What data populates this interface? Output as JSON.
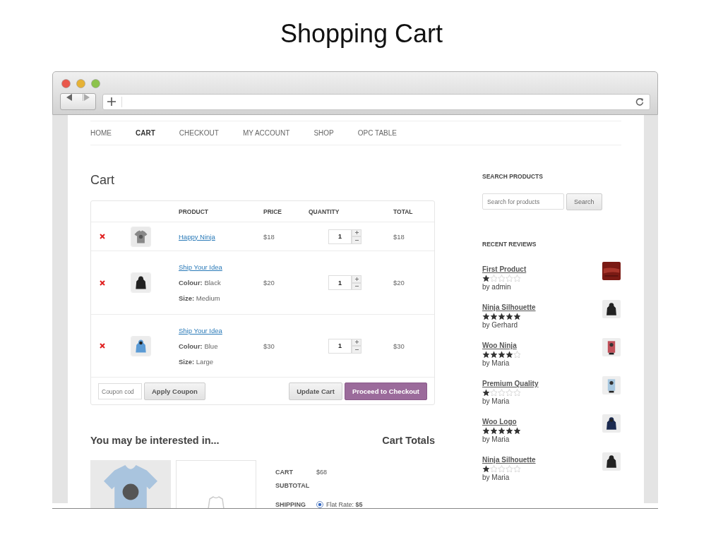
{
  "slide_title": "Shopping Cart",
  "nav": [
    {
      "label": "HOME",
      "selected": false
    },
    {
      "label": "CART",
      "selected": true
    },
    {
      "label": "CHECKOUT",
      "selected": false
    },
    {
      "label": "MY ACCOUNT",
      "selected": false
    },
    {
      "label": "SHOP",
      "selected": false
    },
    {
      "label": "OPC TABLE",
      "selected": false
    }
  ],
  "page_title": "Cart",
  "cart": {
    "columns": [
      "PRODUCT",
      "PRICE",
      "QUANTITY",
      "TOTAL"
    ],
    "rows": [
      {
        "product": "Happy Ninja",
        "attributes": [],
        "price": "$18",
        "quantity": "1",
        "total": "$18"
      },
      {
        "product": "Ship Your Idea",
        "attributes": [
          {
            "label": "Colour:",
            "value": "Black"
          },
          {
            "label": "Size:",
            "value": "Medium"
          }
        ],
        "price": "$20",
        "quantity": "1",
        "total": "$20"
      },
      {
        "product": "Ship Your Idea",
        "attributes": [
          {
            "label": "Colour:",
            "value": "Blue"
          },
          {
            "label": "Size:",
            "value": "Large"
          }
        ],
        "price": "$30",
        "quantity": "1",
        "total": "$30"
      }
    ],
    "coupon": {
      "placeholder": "Coupon cod"
    },
    "buttons": [
      {
        "label": "Apply Coupon",
        "kind": "plain"
      },
      {
        "label": "Update Cart",
        "kind": "plain"
      },
      {
        "label": "Proceed to Checkout",
        "kind": "primary"
      }
    ]
  },
  "interested_heading": "You may be interested in...",
  "cart_totals": {
    "heading": "Cart Totals",
    "rows": [
      {
        "label": "CART SUBTOTAL",
        "value": "$68",
        "kind": "text"
      },
      {
        "label": "SHIPPING",
        "value": "Flat Rate: **$5**",
        "kind": "radio",
        "selected": true
      }
    ]
  },
  "sidebar": {
    "search_heading": "SEARCH PRODUCTS",
    "search": {
      "placeholder": "Search for products"
    },
    "search_button": "Search",
    "reviews_heading": "RECENT REVIEWS",
    "reviews": [
      {
        "title": "First Product",
        "stars": 1,
        "author": "by admin"
      },
      {
        "title": "Ninja Silhouette",
        "stars": 5,
        "author": "by Gerhard"
      },
      {
        "title": "Woo Ninja",
        "stars": 4,
        "author": "by Maria"
      },
      {
        "title": "Premium Quality",
        "stars": 1,
        "author": "by Maria"
      },
      {
        "title": "Woo Logo",
        "stars": 5,
        "author": "by Maria"
      },
      {
        "title": "Ninja Silhouette",
        "stars": 1,
        "author": "by Maria"
      }
    ]
  }
}
